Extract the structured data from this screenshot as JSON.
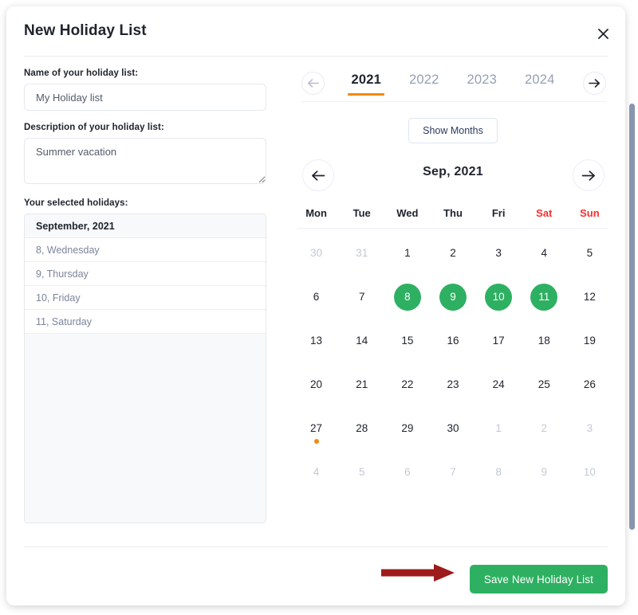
{
  "dialog": {
    "title": "New Holiday List",
    "close_icon": "close-icon"
  },
  "form": {
    "name_label": "Name of your holiday list:",
    "name_value": "My Holiday list",
    "name_placeholder": "",
    "description_label": "Description of your holiday list:",
    "description_value": "Summer vacation",
    "description_placeholder": "",
    "selected_label": "Your selected holidays:"
  },
  "selected_holidays": {
    "group_header": "September, 2021",
    "items": [
      "8, Wednesday",
      "9, Thursday",
      "10, Friday",
      "11, Saturday"
    ]
  },
  "year_selector": {
    "prev_icon": "arrow-left-icon",
    "next_icon": "arrow-right-icon",
    "prev_disabled": true,
    "active_year": "2021",
    "years": [
      "2021",
      "2022",
      "2023",
      "2024"
    ]
  },
  "show_months_label": "Show Months",
  "month_nav": {
    "prev_icon": "arrow-left-icon",
    "next_icon": "arrow-right-icon",
    "title": "Sep, 2021"
  },
  "calendar": {
    "weekdays": [
      {
        "label": "Mon",
        "weekend": false
      },
      {
        "label": "Tue",
        "weekend": false
      },
      {
        "label": "Wed",
        "weekend": false
      },
      {
        "label": "Thu",
        "weekend": false
      },
      {
        "label": "Fri",
        "weekend": false
      },
      {
        "label": "Sat",
        "weekend": true
      },
      {
        "label": "Sun",
        "weekend": true
      }
    ],
    "days": [
      {
        "n": "30",
        "muted": true,
        "selected": false,
        "today": false
      },
      {
        "n": "31",
        "muted": true,
        "selected": false,
        "today": false
      },
      {
        "n": "1",
        "muted": false,
        "selected": false,
        "today": false
      },
      {
        "n": "2",
        "muted": false,
        "selected": false,
        "today": false
      },
      {
        "n": "3",
        "muted": false,
        "selected": false,
        "today": false
      },
      {
        "n": "4",
        "muted": false,
        "selected": false,
        "today": false
      },
      {
        "n": "5",
        "muted": false,
        "selected": false,
        "today": false
      },
      {
        "n": "6",
        "muted": false,
        "selected": false,
        "today": false
      },
      {
        "n": "7",
        "muted": false,
        "selected": false,
        "today": false
      },
      {
        "n": "8",
        "muted": false,
        "selected": true,
        "today": false
      },
      {
        "n": "9",
        "muted": false,
        "selected": true,
        "today": false
      },
      {
        "n": "10",
        "muted": false,
        "selected": true,
        "today": false
      },
      {
        "n": "11",
        "muted": false,
        "selected": true,
        "today": false
      },
      {
        "n": "12",
        "muted": false,
        "selected": false,
        "today": false
      },
      {
        "n": "13",
        "muted": false,
        "selected": false,
        "today": false
      },
      {
        "n": "14",
        "muted": false,
        "selected": false,
        "today": false
      },
      {
        "n": "15",
        "muted": false,
        "selected": false,
        "today": false
      },
      {
        "n": "16",
        "muted": false,
        "selected": false,
        "today": false
      },
      {
        "n": "17",
        "muted": false,
        "selected": false,
        "today": false
      },
      {
        "n": "18",
        "muted": false,
        "selected": false,
        "today": false
      },
      {
        "n": "19",
        "muted": false,
        "selected": false,
        "today": false
      },
      {
        "n": "20",
        "muted": false,
        "selected": false,
        "today": false
      },
      {
        "n": "21",
        "muted": false,
        "selected": false,
        "today": false
      },
      {
        "n": "22",
        "muted": false,
        "selected": false,
        "today": false
      },
      {
        "n": "23",
        "muted": false,
        "selected": false,
        "today": false
      },
      {
        "n": "24",
        "muted": false,
        "selected": false,
        "today": false
      },
      {
        "n": "25",
        "muted": false,
        "selected": false,
        "today": false
      },
      {
        "n": "26",
        "muted": false,
        "selected": false,
        "today": false
      },
      {
        "n": "27",
        "muted": false,
        "selected": false,
        "today": true
      },
      {
        "n": "28",
        "muted": false,
        "selected": false,
        "today": false
      },
      {
        "n": "29",
        "muted": false,
        "selected": false,
        "today": false
      },
      {
        "n": "30",
        "muted": false,
        "selected": false,
        "today": false
      },
      {
        "n": "1",
        "muted": true,
        "selected": false,
        "today": false
      },
      {
        "n": "2",
        "muted": true,
        "selected": false,
        "today": false
      },
      {
        "n": "3",
        "muted": true,
        "selected": false,
        "today": false
      },
      {
        "n": "4",
        "muted": true,
        "selected": false,
        "today": false
      },
      {
        "n": "5",
        "muted": true,
        "selected": false,
        "today": false
      },
      {
        "n": "6",
        "muted": true,
        "selected": false,
        "today": false
      },
      {
        "n": "7",
        "muted": true,
        "selected": false,
        "today": false
      },
      {
        "n": "8",
        "muted": true,
        "selected": false,
        "today": false
      },
      {
        "n": "9",
        "muted": true,
        "selected": false,
        "today": false
      },
      {
        "n": "10",
        "muted": true,
        "selected": false,
        "today": false
      }
    ]
  },
  "footer": {
    "save_label": "Save New Holiday List"
  },
  "colors": {
    "accent_green": "#2eb062",
    "accent_orange": "#f28a0c",
    "weekend_red": "#fa2e2e",
    "annotation_red": "#9e1b1b"
  }
}
